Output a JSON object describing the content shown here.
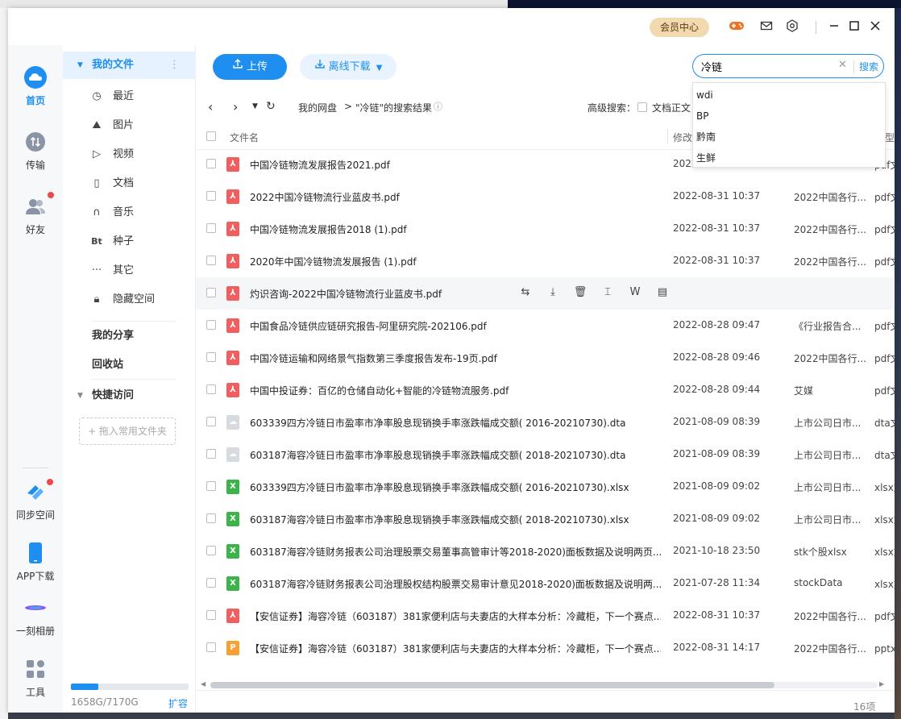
{
  "titlebar": {
    "vip_label": "会员中心",
    "icons": [
      "gamepad-icon",
      "mail-icon",
      "settings-icon",
      "minimize-icon",
      "maximize-icon",
      "close-icon"
    ]
  },
  "rail": {
    "items": [
      {
        "label": "首页",
        "active": true
      },
      {
        "label": "传输"
      },
      {
        "label": "好友"
      },
      {
        "label": "同步空间"
      },
      {
        "label": "APP下载"
      },
      {
        "label": "一刻相册"
      },
      {
        "label": "工具"
      }
    ]
  },
  "sidebar": {
    "my_files": "我的文件",
    "items": [
      {
        "label": "最近",
        "icon": "clock-icon"
      },
      {
        "label": "图片",
        "icon": "image-icon"
      },
      {
        "label": "视频",
        "icon": "play-icon"
      },
      {
        "label": "文档",
        "icon": "document-icon"
      },
      {
        "label": "音乐",
        "icon": "headphones-icon"
      },
      {
        "label": "种子",
        "icon": "bt-icon",
        "glyph": "Bt"
      },
      {
        "label": "其它",
        "icon": "more-icon"
      },
      {
        "label": "隐藏空间",
        "icon": "lock-icon"
      }
    ],
    "my_share": "我的分享",
    "recycle": "回收站",
    "quick_access": "快捷访问",
    "drop_hint": "+ 拖入常用文件夹",
    "quota_text": "1658G/7170G",
    "quota_fraction": 0.231,
    "expand_label": "扩容"
  },
  "toolbar": {
    "upload_label": "上传",
    "offline_label": "离线下载",
    "search_value": "冷链",
    "search_button": "搜索"
  },
  "suggestions": [
    "wdi",
    "BP",
    "黔南",
    "生鲜"
  ],
  "nav": {
    "crumb_root": "我的网盘",
    "crumb_sep": ">",
    "crumb_current": "\"冷链\"的搜索结果",
    "advanced_label": "高级搜索：",
    "fulltext_label": "文档正文"
  },
  "columns": {
    "name": "文件名",
    "modified": "修改",
    "type": "型"
  },
  "files": [
    {
      "name": "中国冷链物流发展报告2021.pdf",
      "date": "2022",
      "dir": "",
      "type": "pdf文",
      "kind": "pdf"
    },
    {
      "name": "2022中国冷链物流行业蓝皮书.pdf",
      "date": "2022-08-31 10:37",
      "dir": "2022中国各行...",
      "type": "pdf文",
      "kind": "pdf"
    },
    {
      "name": "中国冷链物流发展报告2018 (1).pdf",
      "date": "2022-08-31 10:37",
      "dir": "2022中国各行...",
      "type": "pdf文",
      "kind": "pdf"
    },
    {
      "name": "2020年中国冷链物流发展报告 (1).pdf",
      "date": "2022-08-31 10:37",
      "dir": "2022中国各行...",
      "type": "pdf文",
      "kind": "pdf"
    },
    {
      "name": "灼识咨询-2022中国冷链物流行业蓝皮书.pdf",
      "date": "",
      "dir": "",
      "type": "",
      "kind": "pdf",
      "hover": true
    },
    {
      "name": "中国食品冷链供应链研究报告-阿里研究院-202106.pdf",
      "date": "2022-08-28 09:47",
      "dir": "《行业报告合...",
      "type": "pdf文",
      "kind": "pdf"
    },
    {
      "name": "中国冷链运输和网络景气指数第三季度报告发布-19页.pdf",
      "date": "2022-08-28 09:46",
      "dir": "2022中国各行...",
      "type": "pdf文",
      "kind": "pdf"
    },
    {
      "name": "中国中投证券：百亿的仓储自动化+智能的冷链物流服务.pdf",
      "date": "2022-08-28 09:44",
      "dir": "艾媒",
      "type": "pdf文",
      "kind": "pdf"
    },
    {
      "name": "603339四方冷链日市盈率市净率股息现销换手率涨跌幅成交额( 2016-20210730).dta",
      "date": "2021-08-09 08:39",
      "dir": "上市公司日市...",
      "type": "dta文",
      "kind": "dta"
    },
    {
      "name": "603187海容冷链日市盈率市净率股息现销换手率涨跌幅成交额( 2018-20210730).dta",
      "date": "2021-08-09 08:39",
      "dir": "上市公司日市...",
      "type": "dta文",
      "kind": "dta"
    },
    {
      "name": "603339四方冷链日市盈率市净率股息现销换手率涨跌幅成交额( 2016-20210730).xlsx",
      "date": "2021-08-09 09:02",
      "dir": "上市公司日市...",
      "type": "xlsx文",
      "kind": "xlsx"
    },
    {
      "name": "603187海容冷链日市盈率市净率股息现销换手率涨跌幅成交额( 2018-20210730).xlsx",
      "date": "2021-08-09 09:02",
      "dir": "上市公司日市...",
      "type": "xlsx文",
      "kind": "xlsx"
    },
    {
      "name": "603187海容冷链财务报表公司治理股票交易董事高管审计等2018-2020)面板数据及说明两页...",
      "date": "2021-10-18 23:50",
      "dir": "stk个股xlsx",
      "type": "xlsx文",
      "kind": "xlsx"
    },
    {
      "name": "603187海容冷链财务报表公司治理股权结构股票交易审计意见2018-2020)面板数据及说明两...",
      "date": "2021-07-28 11:34",
      "dir": "stockData",
      "type": "xlsx文",
      "kind": "xlsx"
    },
    {
      "name": "【安信证券】海容冷链（603187）381家便利店与夫妻店的大样本分析：冷藏柜，下一个赛点...",
      "date": "2022-08-31 10:37",
      "dir": "2022中国各行...",
      "type": "pdf文",
      "kind": "pdf"
    },
    {
      "name": "【安信证券】海容冷链（603187）381家便利店与夫妻店的大样本分析：冷藏柜，下一个赛点...",
      "date": "2022-08-31 14:17",
      "dir": "2022中国各行...",
      "type": "pptx文",
      "kind": "pptx"
    }
  ],
  "row_actions": [
    "share-icon",
    "download-icon",
    "delete-icon",
    "rename-icon",
    "word-icon",
    "more-file-icon"
  ],
  "footer": {
    "count": "16项"
  },
  "colors": {
    "accent": "#1e8ff0",
    "vip_bg": "#f1d9b0",
    "pdf": "#f25d5d",
    "xlsx": "#3cb44b",
    "pptx": "#f7a033"
  }
}
